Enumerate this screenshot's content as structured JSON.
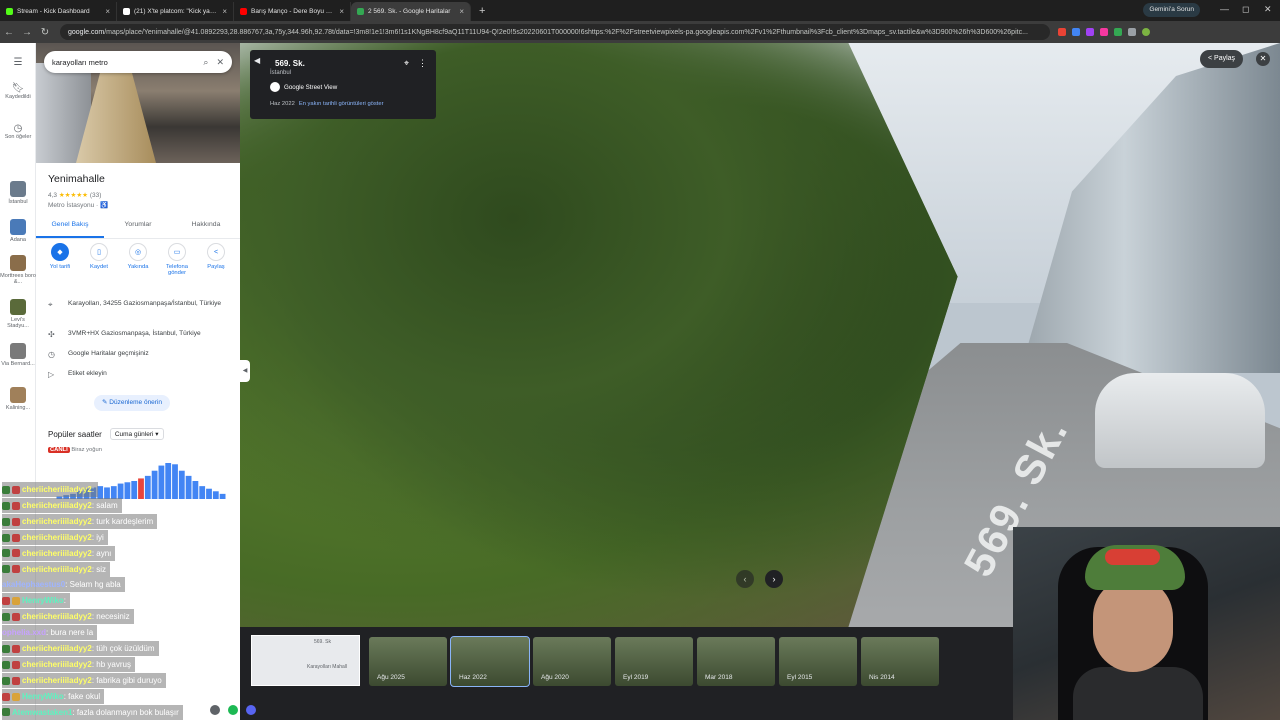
{
  "browser": {
    "tabs": [
      {
        "title": "Stream - Kick Dashboard",
        "color": "#53fc18",
        "active": false
      },
      {
        "title": "(21) X'te platcom: \"Kick yayıncı...",
        "color": "#ffffff",
        "active": false
      },
      {
        "title": "Barış Manço - Dere Boyu K...",
        "color": "#ff0000",
        "active": false
      },
      {
        "title": "2 569. Sk. - Google Haritalar",
        "color": "#34a853",
        "active": true
      }
    ],
    "new_tab": "+",
    "gemini_label": "Gemini'a Sorun",
    "url_domain": "google.com",
    "url_rest": "/maps/place/Yenimahalle/@41.0892293,28.886767,3a,75y,344.96h,92.78t/data=!3m8!1e1!3m6!1s1KNgBH8cf9aQ11T11U94-Q!2e0!5s20220601T000000!6shttps:%2F%2Fstreetviewpixels-pa.googleapis.com%2Fv1%2Fthumbnail%3Fcb_client%3Dmaps_sv.tactile&w%3D900%26h%3D600%26pitc..."
  },
  "rail": {
    "items": [
      {
        "label": "Kaydedildi",
        "icon": "bookmark-icon"
      },
      {
        "label": "Son öğeler",
        "icon": "history-icon"
      },
      {
        "label": "İstanbul"
      },
      {
        "label": "Adana"
      },
      {
        "label": "Morttrees boro &..."
      },
      {
        "label": "Levi's Stadyu..."
      },
      {
        "label": "Via Bernard..."
      },
      {
        "label": "Kalining..."
      }
    ]
  },
  "panel": {
    "search_value": "karayolları metro",
    "place_name": "Yenimahalle",
    "rating": "4,3",
    "stars": "★★★★★",
    "review_count": "(33)",
    "category": "Metro İstasyonu · ♿",
    "tabs": [
      "Genel Bakış",
      "Yorumlar",
      "Hakkında"
    ],
    "actions": [
      {
        "label": "Yol tarifi",
        "icon": "directions-icon"
      },
      {
        "label": "Kaydet",
        "icon": "bookmark-icon"
      },
      {
        "label": "Yakında",
        "icon": "nearby-icon"
      },
      {
        "label": "Telefona gönder",
        "icon": "phone-icon"
      },
      {
        "label": "Paylaş",
        "icon": "share-icon"
      }
    ],
    "info": [
      {
        "text": "Karayolları, 34255 Gaziosmanpaşa/İstanbul, Türkiye",
        "icon": "pin-icon"
      },
      {
        "text": "3VMR+HX Gaziosmanpaşa, İstanbul, Türkiye",
        "icon": "pluscode-icon"
      },
      {
        "text": "Google Haritalar geçmişiniz",
        "icon": "history-icon"
      },
      {
        "text": "Etiket ekleyin",
        "icon": "label-icon"
      }
    ],
    "suggest_edit": "Düzenleme önerin",
    "popular_title": "Popüler saatler",
    "day": "Cuma günleri",
    "live": "CANLI",
    "live_text": "Biraz yoğun",
    "bar_values": [
      2,
      3,
      4,
      6,
      8,
      9,
      10,
      9,
      10,
      12,
      13,
      14,
      16,
      18,
      22,
      26,
      28,
      27,
      22,
      18,
      14,
      10,
      8,
      6,
      4
    ]
  },
  "streetview": {
    "street": "569. Sk.",
    "city": "İstanbul",
    "brand": "Google Street View",
    "date": "Haz 2022",
    "date_link": "En yakın tarihli görüntüleri göster",
    "road_text": "569. Sk.",
    "share_label": "Paylaş",
    "minimap_label1": "569. Sk",
    "minimap_label2": "Karayolları Mahall",
    "timeline": [
      "Ağu 2025",
      "Haz 2022",
      "Ağu 2020",
      "Eyl 2019",
      "Mar 2018",
      "Eyl 2015",
      "Nis 2014"
    ]
  },
  "chat": [
    {
      "user": "cheriicheriiiladyy2",
      "text": ":",
      "color": "#ffff66",
      "badges": [
        "#3a7d3a",
        "#c04040"
      ]
    },
    {
      "user": "cheriicheriiiladyy2",
      "text": ": salam",
      "color": "#ffff66",
      "badges": [
        "#3a7d3a",
        "#c04040"
      ]
    },
    {
      "user": "cheriicheriiiladyy2",
      "text": ": turk kardeşlerim",
      "color": "#ffff66",
      "badges": [
        "#3a7d3a",
        "#c04040"
      ]
    },
    {
      "user": "cheriicheriiiladyy2",
      "text": ": iyi",
      "color": "#ffff66",
      "badges": [
        "#3a7d3a",
        "#c04040"
      ]
    },
    {
      "user": "cheriicheriiiladyy2",
      "text": ": aynı",
      "color": "#ffff66",
      "badges": [
        "#3a7d3a",
        "#c04040"
      ]
    },
    {
      "user": "cheriicheriiiladyy2",
      "text": ": siz",
      "color": "#ffff66",
      "badges": [
        "#3a7d3a",
        "#c04040"
      ]
    },
    {
      "user": "akaHephaestus0",
      "text": ": Selam hg abla",
      "color": "#9fb4ff",
      "badges": []
    },
    {
      "user": "HenryWiko",
      "text": ":",
      "color": "#5cf5c0",
      "badges": [
        "#c04040",
        "#d9a33a"
      ]
    },
    {
      "user": "cheriicheriiiladyy2",
      "text": ": necesiniz",
      "color": "#ffff66",
      "badges": [
        "#3a7d3a",
        "#c04040"
      ]
    },
    {
      "user": "ophelia.xxd",
      "text": ": bura nere la",
      "color": "#c7a1ff",
      "badges": []
    },
    {
      "user": "cheriicheriiiladyy2",
      "text": ": tüh çok üzüldüm",
      "color": "#ffff66",
      "badges": [
        "#3a7d3a",
        "#c04040"
      ]
    },
    {
      "user": "cheriicheriiiladyy2",
      "text": ": hb yavruş",
      "color": "#ffff66",
      "badges": [
        "#3a7d3a",
        "#c04040"
      ]
    },
    {
      "user": "cheriicheriiiladyy2",
      "text": ": fabrika gibi duruyo",
      "color": "#ffff66",
      "badges": [
        "#3a7d3a",
        "#c04040"
      ]
    },
    {
      "user": "HenryWiko",
      "text": ": fake okul",
      "color": "#5cf5c0",
      "badges": [
        "#c04040",
        "#d9a33a"
      ]
    },
    {
      "user": "Atemwastaken1",
      "text": ": fazla dolanmayın bok bulaşır",
      "color": "#5cf5c0",
      "badges": [
        "#3a7d3a"
      ]
    }
  ]
}
